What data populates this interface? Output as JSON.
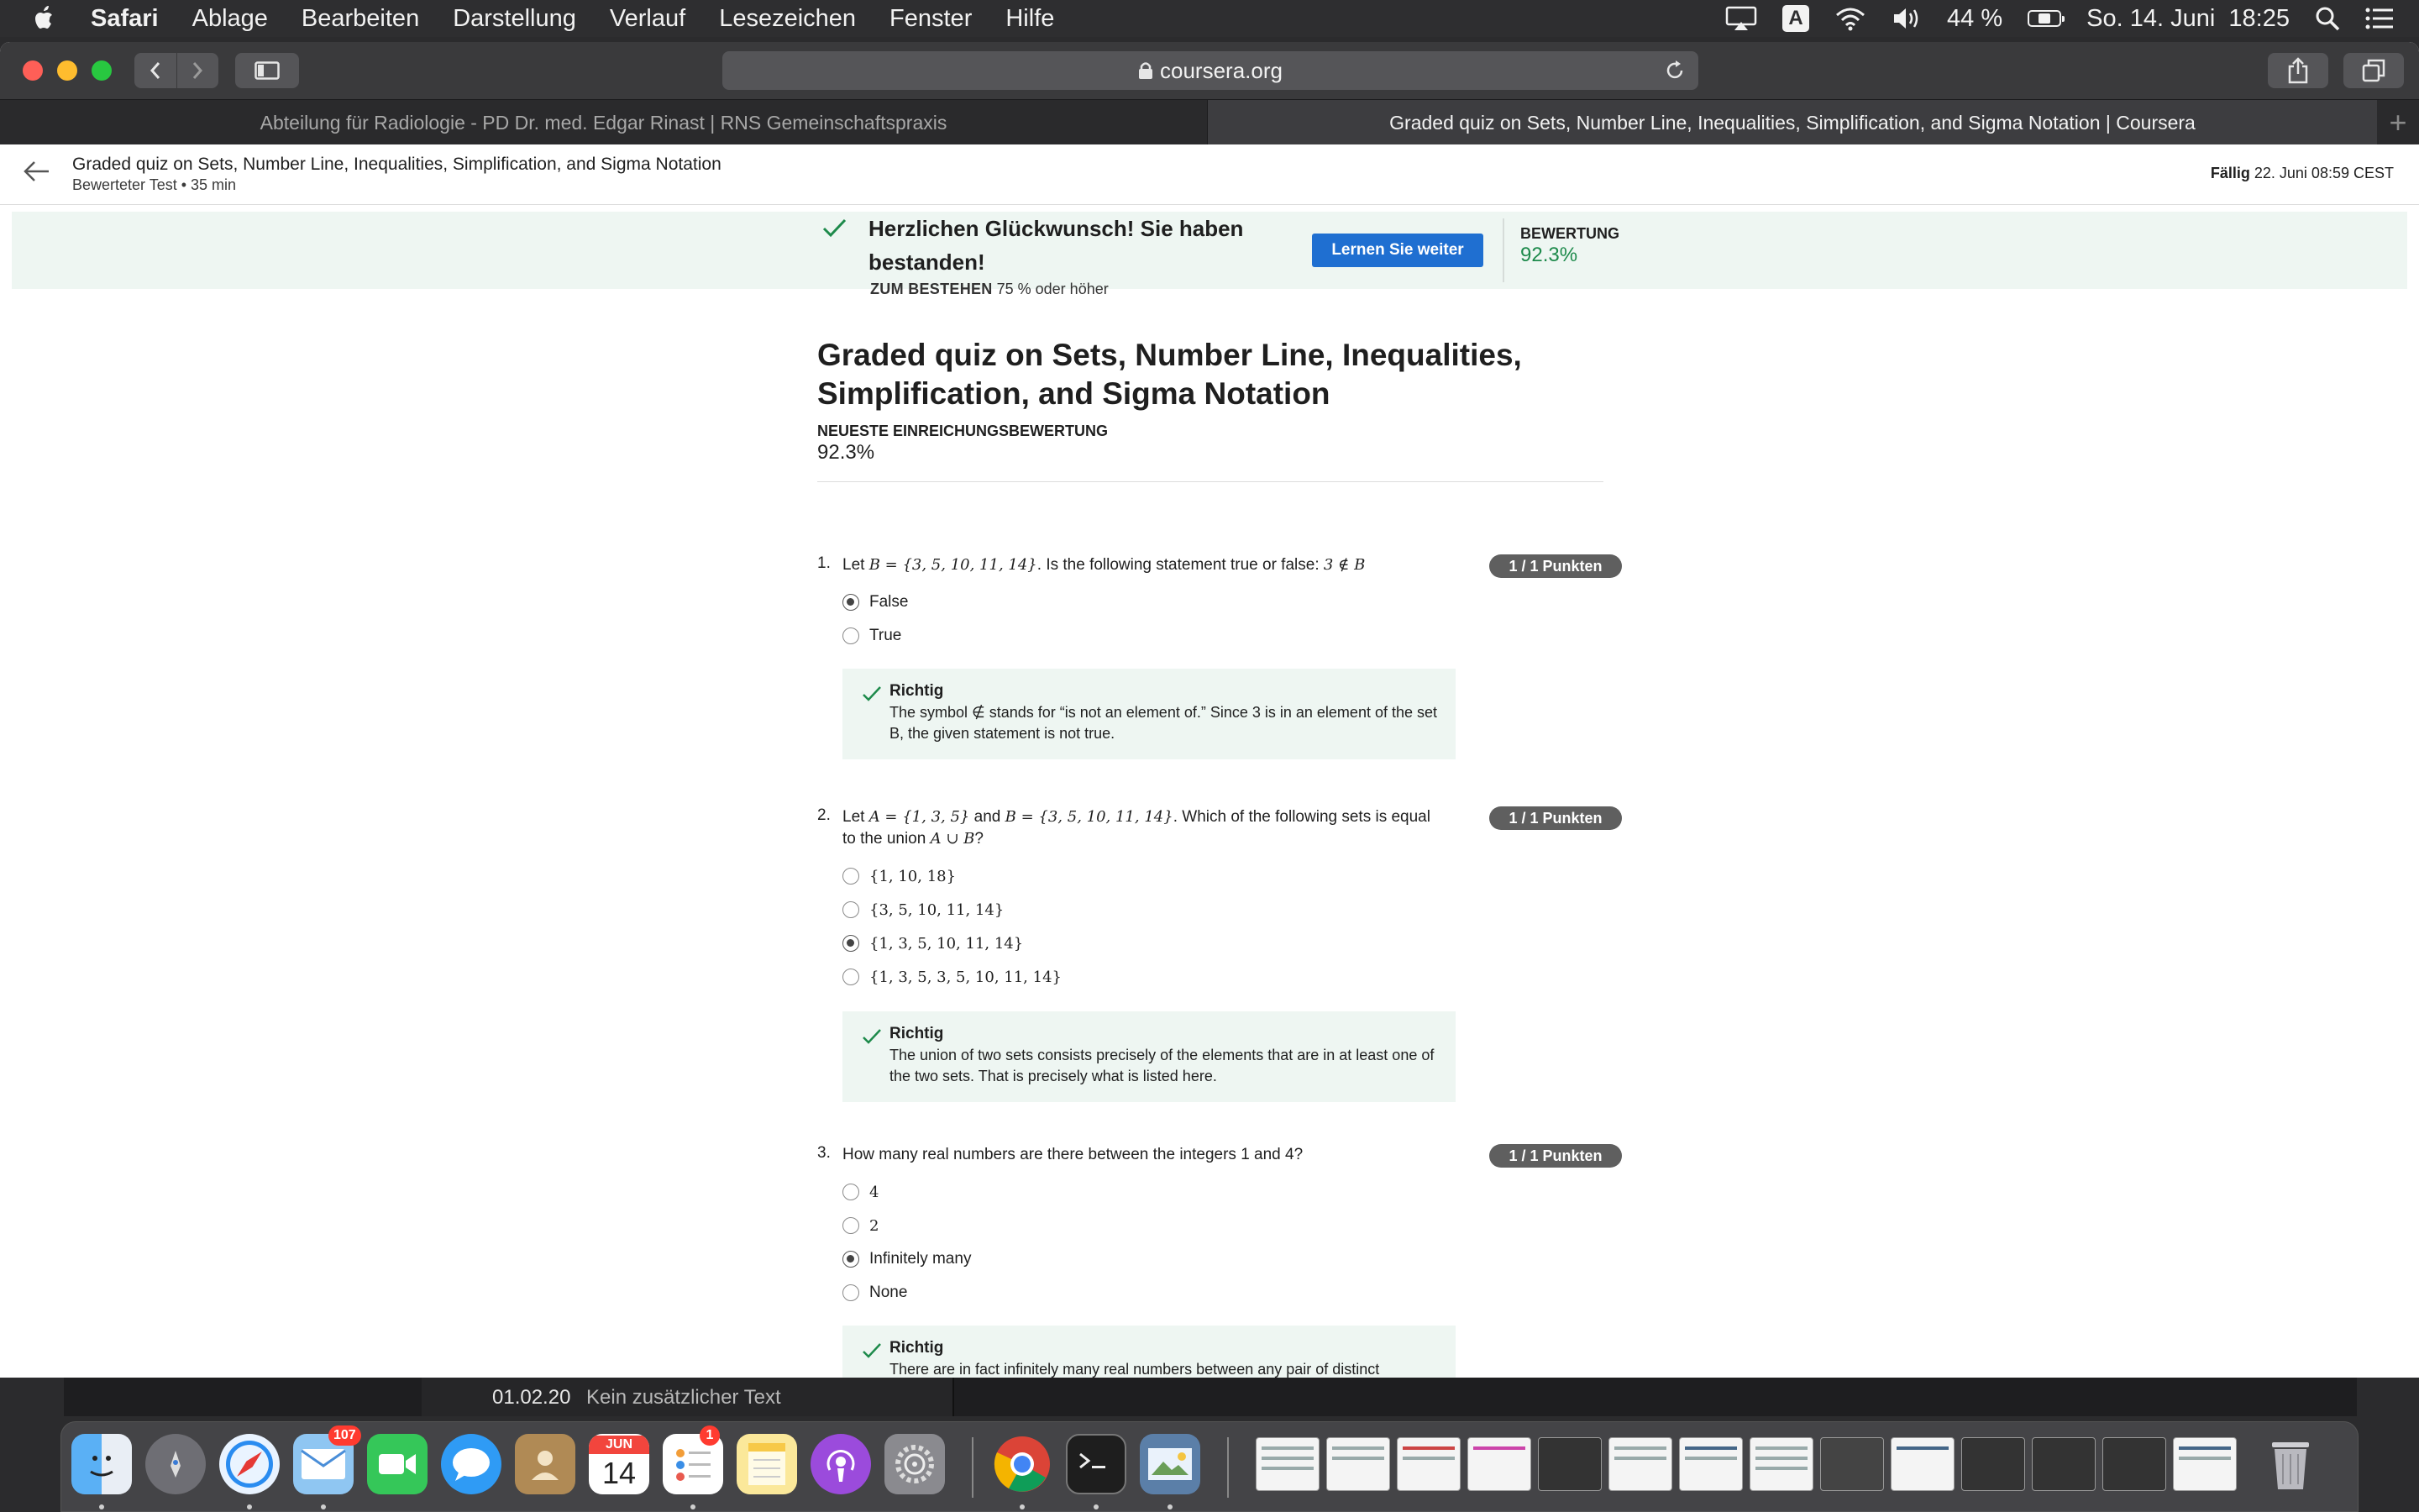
{
  "menubar": {
    "app": "Safari",
    "items": [
      "Ablage",
      "Bearbeiten",
      "Darstellung",
      "Verlauf",
      "Lesezeichen",
      "Fenster",
      "Hilfe"
    ],
    "input_source": "A",
    "battery": "44 %",
    "battery_level": 0.44,
    "datetime": "So. 14. Juni  18:25"
  },
  "browser": {
    "url": "coursera.org",
    "tabs": [
      {
        "label": "Abteilung für Radiologie - PD Dr. med. Edgar Rinast | RNS Gemeinschaftspraxis",
        "active": false
      },
      {
        "label": "Graded quiz on Sets, Number Line, Inequalities, Simplification, and Sigma Notation | Coursera",
        "active": true
      }
    ],
    "new_tab": "+"
  },
  "header": {
    "title": "Graded quiz on Sets, Number Line, Inequalities, Simplification, and Sigma Notation",
    "subtitle": "Bewerteter Test • 35 min",
    "due_label": "Fällig",
    "due_value": "22. Juni 08:59 CEST"
  },
  "banner": {
    "title": "Herzlichen Glückwunsch! Sie haben bestanden!",
    "pass_label": "ZUM BESTEHEN",
    "pass_value": "75 % oder höher",
    "button": "Lernen Sie weiter",
    "score_label": "BEWERTUNG",
    "score_value": "92.3%"
  },
  "quiz": {
    "title": "Graded quiz on Sets, Number Line, Inequalities, Simplification, and Sigma Notation",
    "latest_label": "NEUESTE EINREICHUNGSBEWERTUNG",
    "latest_value": "92.3%",
    "questions": [
      {
        "number": "1.",
        "text_parts": [
          "Let ",
          "B = {3, 5, 10, 11, 14}",
          ". Is the following statement true or false: ",
          "3 ∉ B"
        ],
        "points": "1 / 1 Punkten",
        "options": [
          {
            "label": "False",
            "checked": true
          },
          {
            "label": "True",
            "checked": false
          }
        ],
        "feedback": {
          "title": "Richtig",
          "text": "The symbol ∉ stands for “is not an element of.” Since 3 is in an element of the set B, the given statement is not true."
        }
      },
      {
        "number": "2.",
        "text_parts": [
          "Let ",
          "A = {1, 3, 5}",
          " and ",
          "B = {3, 5, 10, 11, 14}",
          ". Which of the following sets is equal to the union ",
          "A ∪ B",
          "?"
        ],
        "points": "1 / 1 Punkten",
        "options": [
          {
            "label": "{1, 10, 18}",
            "checked": false
          },
          {
            "label": "{3, 5, 10, 11, 14}",
            "checked": false
          },
          {
            "label": "{1, 3, 5, 10, 11, 14}",
            "checked": true
          },
          {
            "label": "{1, 3, 5, 3, 5, 10, 11, 14}",
            "checked": false
          }
        ],
        "feedback": {
          "title": "Richtig",
          "text": "The union of two sets consists precisely of the elements that are in at least one of the two sets. That is precisely what is listed here."
        }
      },
      {
        "number": "3.",
        "text_parts": [
          "How many real numbers are there between the integers 1 and 4?"
        ],
        "points": "1 / 1 Punkten",
        "options": [
          {
            "label": "4",
            "checked": false
          },
          {
            "label": "2",
            "checked": false
          },
          {
            "label": "Infinitely many",
            "checked": true
          },
          {
            "label": "None",
            "checked": false
          }
        ],
        "feedback": {
          "title": "Richtig",
          "text": "There are in fact infinitely many real numbers between any pair of distinct integers, or indeed any pair of distinct real numbers!"
        }
      }
    ]
  },
  "background_app": {
    "date": "01.02.20",
    "note": "Kein zusätzlicher Text"
  },
  "dock": {
    "badges": {
      "mail": "107",
      "reminders": "1"
    },
    "calendar_month": "JUN",
    "calendar_day": "14"
  },
  "colors": {
    "accent_blue": "#1f6fd1",
    "success_green": "#1d8a4b",
    "banner_bg": "#eef6f2"
  }
}
